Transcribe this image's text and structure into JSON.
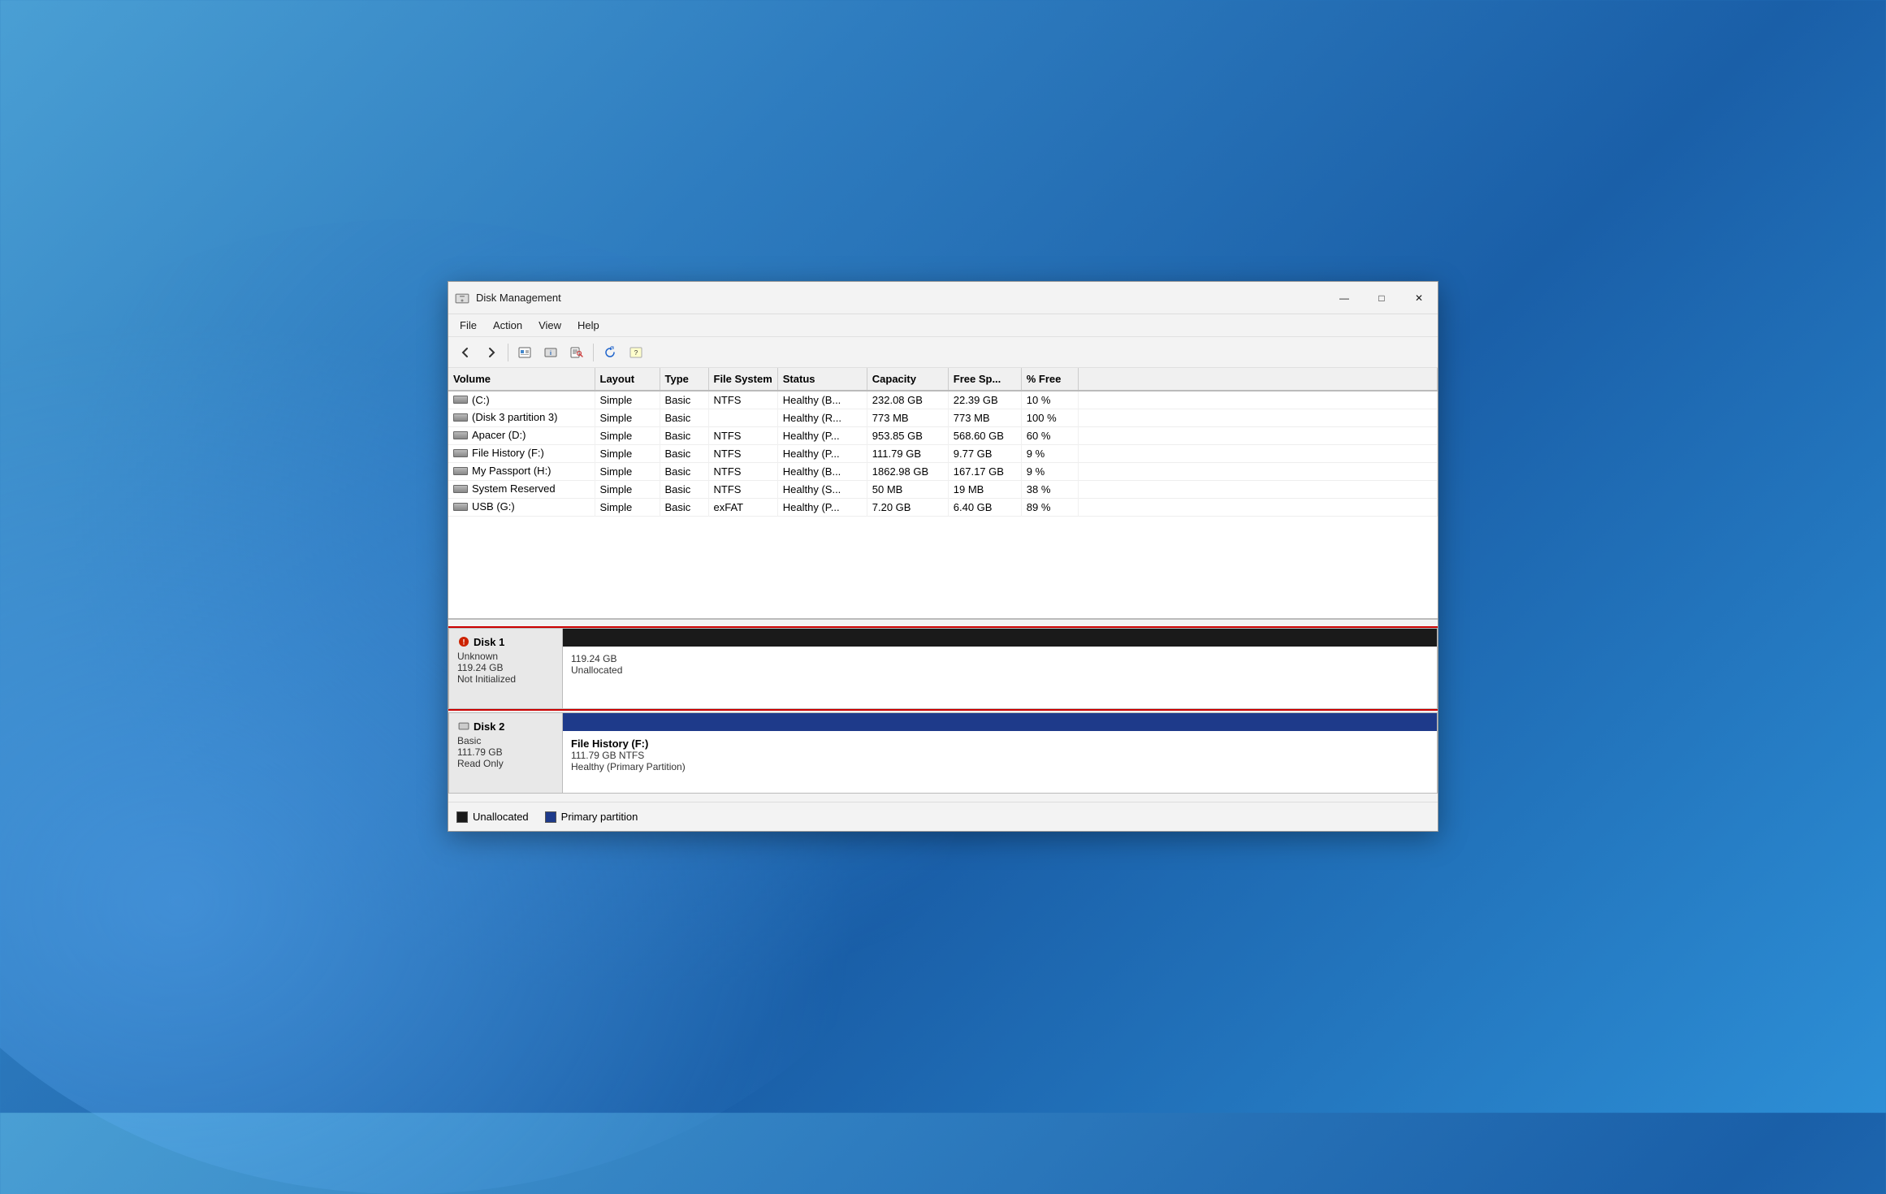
{
  "window": {
    "title": "Disk Management",
    "icon": "💿"
  },
  "menu": {
    "items": [
      "File",
      "Action",
      "View",
      "Help"
    ]
  },
  "toolbar": {
    "buttons": [
      "◀",
      "▶",
      "📋",
      "🔑",
      "📑",
      "➡",
      "✓",
      "🖥"
    ]
  },
  "table": {
    "columns": [
      "Volume",
      "Layout",
      "Type",
      "File System",
      "Status",
      "Capacity",
      "Free Sp...",
      "% Free"
    ],
    "rows": [
      {
        "volume": "(C:)",
        "layout": "Simple",
        "type": "Basic",
        "fs": "NTFS",
        "status": "Healthy (B...",
        "capacity": "232.08 GB",
        "free": "22.39 GB",
        "pct": "10 %"
      },
      {
        "volume": "(Disk 3 partition 3)",
        "layout": "Simple",
        "type": "Basic",
        "fs": "",
        "status": "Healthy (R...",
        "capacity": "773 MB",
        "free": "773 MB",
        "pct": "100 %"
      },
      {
        "volume": "Apacer (D:)",
        "layout": "Simple",
        "type": "Basic",
        "fs": "NTFS",
        "status": "Healthy (P...",
        "capacity": "953.85 GB",
        "free": "568.60 GB",
        "pct": "60 %"
      },
      {
        "volume": "File History (F:)",
        "layout": "Simple",
        "type": "Basic",
        "fs": "NTFS",
        "status": "Healthy (P...",
        "capacity": "111.79 GB",
        "free": "9.77 GB",
        "pct": "9 %"
      },
      {
        "volume": "My Passport (H:)",
        "layout": "Simple",
        "type": "Basic",
        "fs": "NTFS",
        "status": "Healthy (B...",
        "capacity": "1862.98 GB",
        "free": "167.17 GB",
        "pct": "9 %"
      },
      {
        "volume": "System Reserved",
        "layout": "Simple",
        "type": "Basic",
        "fs": "NTFS",
        "status": "Healthy (S...",
        "capacity": "50 MB",
        "free": "19 MB",
        "pct": "38 %"
      },
      {
        "volume": "USB (G:)",
        "layout": "Simple",
        "type": "Basic",
        "fs": "exFAT",
        "status": "Healthy (P...",
        "capacity": "7.20 GB",
        "free": "6.40 GB",
        "pct": "89 %"
      }
    ]
  },
  "disks": [
    {
      "id": "disk1",
      "name": "Disk 1",
      "type": "Unknown",
      "size": "119.24 GB",
      "status": "Not Initialized",
      "selected": true,
      "header_type": "unallocated",
      "partition_label": "",
      "partition_size": "119.24 GB",
      "partition_fs": "",
      "partition_status": "Unallocated",
      "icon_type": "error"
    },
    {
      "id": "disk2",
      "name": "Disk 2",
      "type": "Basic",
      "size": "111.79 GB",
      "status": "Read Only",
      "selected": false,
      "header_type": "primary",
      "partition_label": "File History  (F:)",
      "partition_size": "111.79 GB NTFS",
      "partition_fs": "NTFS",
      "partition_status": "Healthy (Primary Partition)",
      "icon_type": "drive"
    }
  ],
  "legend": {
    "items": [
      {
        "type": "unallocated",
        "label": "Unallocated"
      },
      {
        "type": "primary",
        "label": "Primary partition"
      }
    ]
  },
  "title_controls": {
    "minimize": "—",
    "maximize": "□",
    "close": "✕"
  }
}
